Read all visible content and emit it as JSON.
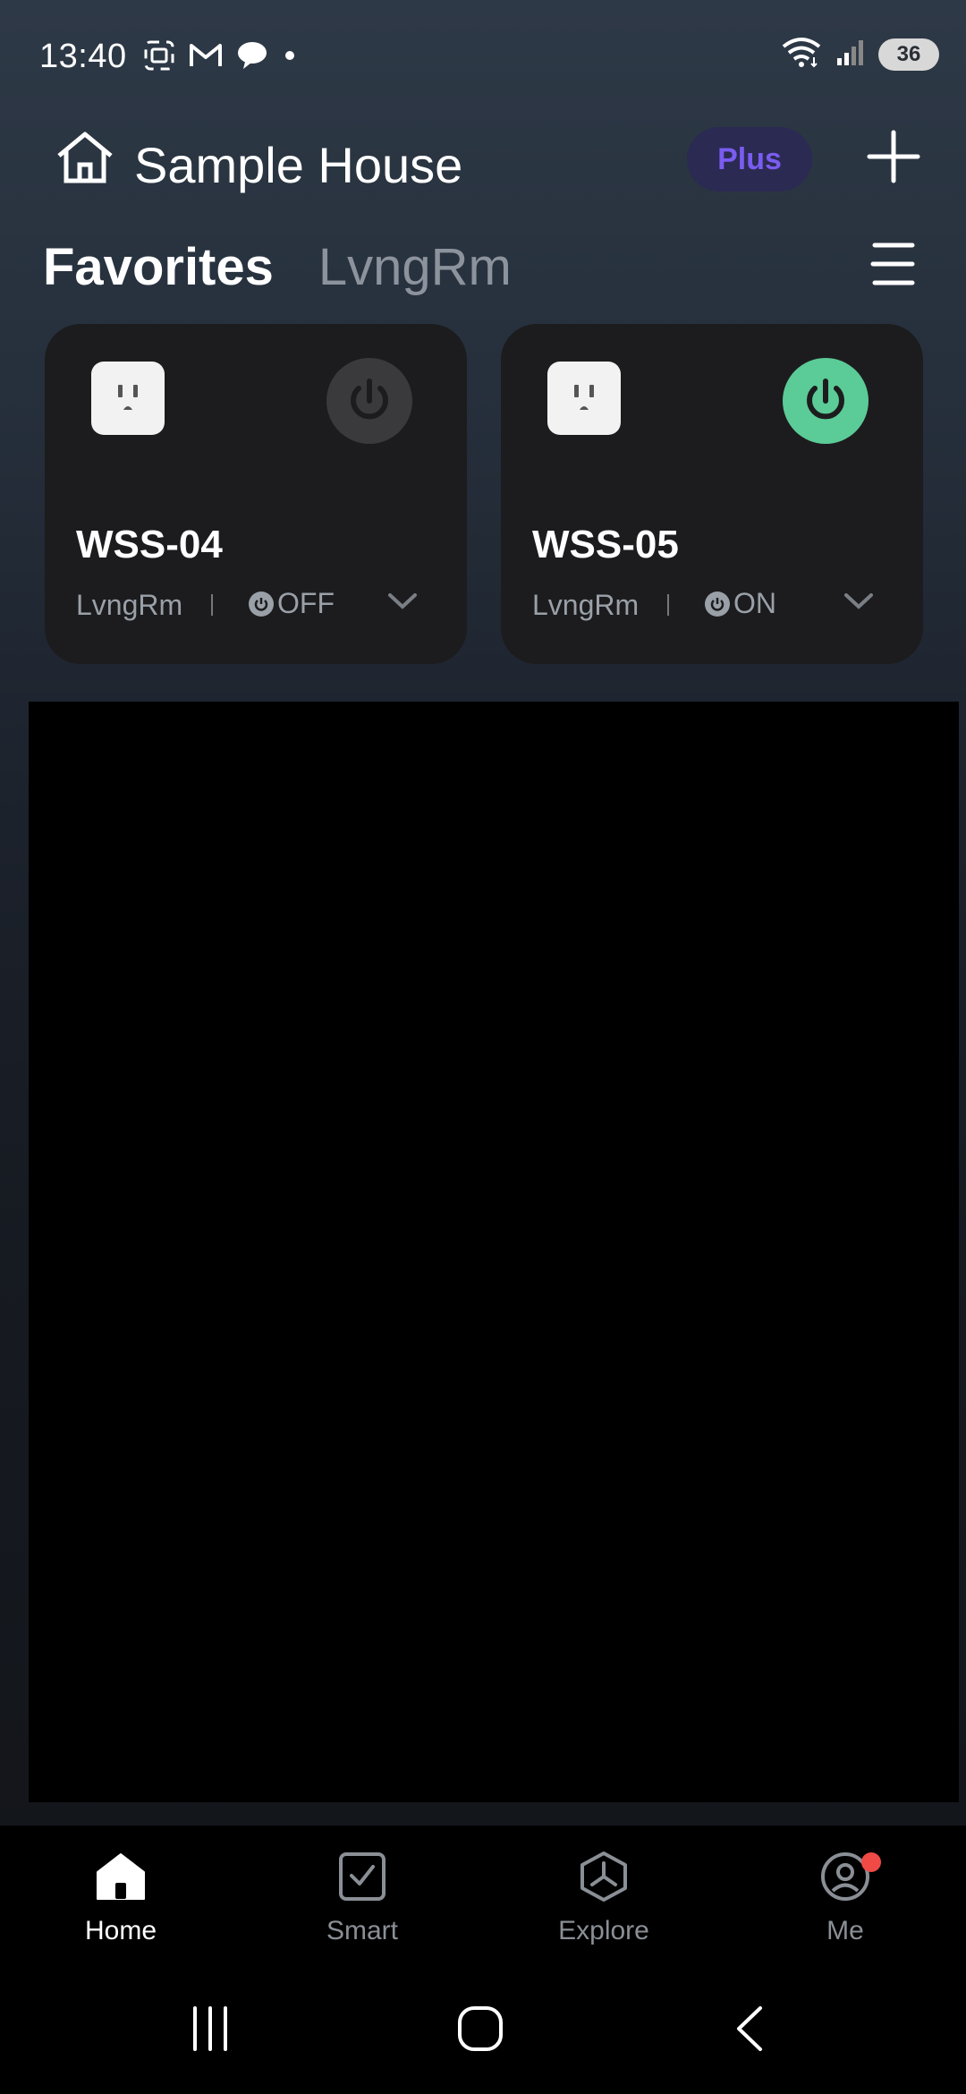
{
  "status_bar": {
    "time": "13:40",
    "battery": "36",
    "icons_left": [
      "screenshot-icon",
      "gmail-icon",
      "chat-icon",
      "dot-icon"
    ],
    "icons_right": [
      "wifi-icon",
      "signal-icon",
      "battery-icon"
    ]
  },
  "header": {
    "house_name": "Sample House",
    "plus_label": "Plus"
  },
  "tabs": [
    {
      "label": "Favorites",
      "active": true
    },
    {
      "label": "LvngRm",
      "active": false
    }
  ],
  "devices": [
    {
      "name": "WSS-04",
      "room": "LvngRm",
      "state": "OFF",
      "power_color": "#3a3a3c"
    },
    {
      "name": "WSS-05",
      "room": "LvngRm",
      "state": "ON",
      "power_color": "#5bcb97"
    }
  ],
  "bottom_nav": [
    {
      "label": "Home",
      "icon": "home-icon",
      "active": true
    },
    {
      "label": "Smart",
      "icon": "check-square-icon",
      "active": false
    },
    {
      "label": "Explore",
      "icon": "explore-icon",
      "active": false
    },
    {
      "label": "Me",
      "icon": "profile-icon",
      "active": false,
      "has_notification": true
    }
  ],
  "colors": {
    "accent_on": "#5bcb97",
    "plus_text": "#7a5cf0",
    "notification": "#ef4a46"
  }
}
